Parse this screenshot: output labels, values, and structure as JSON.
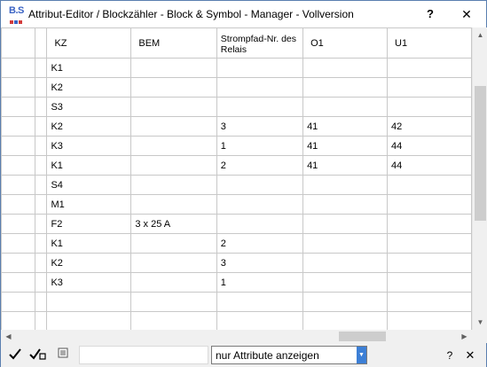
{
  "window": {
    "title": "Attribut-Editor / Blockzähler - Block & Symbol - Manager - Vollversion",
    "icon_text": "B.S",
    "help_label": "?",
    "close_label": "✕"
  },
  "grid": {
    "columns": [
      "",
      "",
      "KZ",
      "BEM",
      "Strompfad-Nr. des Relais",
      "O1",
      "U1"
    ],
    "rows": [
      [
        "K1",
        "",
        "",
        "",
        ""
      ],
      [
        "K2",
        "",
        "",
        "",
        ""
      ],
      [
        "S3",
        "",
        "",
        "",
        ""
      ],
      [
        "K2",
        "",
        "3",
        "41",
        "42"
      ],
      [
        "K3",
        "",
        "1",
        "41",
        "44"
      ],
      [
        "K1",
        "",
        "2",
        "41",
        "44"
      ],
      [
        "S4",
        "",
        "",
        "",
        ""
      ],
      [
        "M1",
        "",
        "",
        "",
        ""
      ],
      [
        "F2",
        "3 x 25 A",
        "",
        "",
        ""
      ],
      [
        "K1",
        "",
        "2",
        "",
        ""
      ],
      [
        "K2",
        "",
        "3",
        "",
        ""
      ],
      [
        "K3",
        "",
        "1",
        "",
        ""
      ],
      [
        "",
        "",
        "",
        "",
        ""
      ],
      [
        "",
        "",
        "",
        "",
        ""
      ]
    ]
  },
  "toolbar": {
    "check_icon": "check-icon",
    "check_all_icon": "check-all-icon",
    "list_icon": "list-icon",
    "input_value": "",
    "filter_selected": "nur Attribute anzeigen",
    "help_label": "?",
    "close_label": "✕"
  },
  "colors": {
    "border": "#5a7fb0",
    "grid_line": "#c8c8c8",
    "select_button": "#3c7fd6",
    "scroll_track": "#f0f0f0",
    "scroll_thumb": "#cdcdcd"
  }
}
